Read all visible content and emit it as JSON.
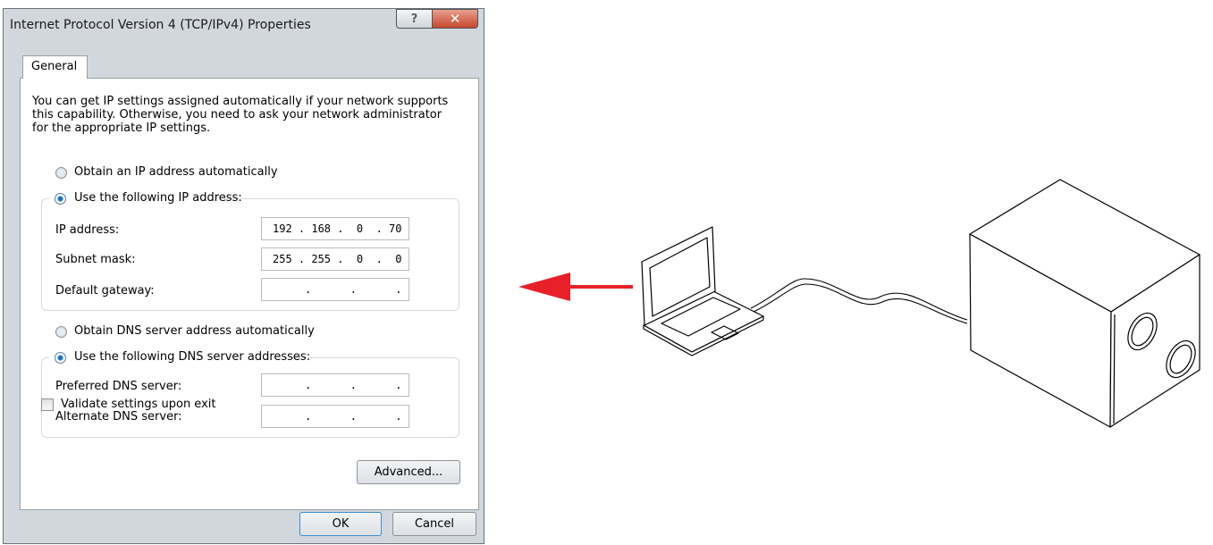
{
  "window": {
    "title": "Internet Protocol Version 4 (TCP/IPv4) Properties",
    "help_glyph": "?",
    "close_glyph": "✕"
  },
  "tabs": [
    {
      "label": "General",
      "selected": true
    }
  ],
  "intro_text": "You can get IP settings assigned automatically if your network supports this capability. Otherwise, you need to ask your network administrator for the appropriate IP settings.",
  "ip_section": {
    "auto_label": "Obtain an IP address automatically",
    "manual_label": "Use the following IP address:",
    "selected": "manual",
    "fields": [
      {
        "label": "IP address:",
        "value": "192 . 168 .  0  . 70"
      },
      {
        "label": "Subnet mask:",
        "value": "255 . 255 .  0  .  0"
      },
      {
        "label": "Default gateway:",
        "value": "     .      .      ."
      }
    ]
  },
  "dns_section": {
    "auto_label": "Obtain DNS server address automatically",
    "manual_label": "Use the following DNS server addresses:",
    "selected": "manual",
    "fields": [
      {
        "label": "Preferred DNS server:",
        "value": "     .      .      ."
      },
      {
        "label": "Alternate DNS server:",
        "value": "     .      .      ."
      }
    ]
  },
  "validate": {
    "label": "Validate settings upon exit",
    "checked": false
  },
  "buttons": {
    "advanced": "Advanced...",
    "ok": "OK",
    "cancel": "Cancel"
  },
  "colors": {
    "arrow": "#e8202a",
    "close_button": "#c7462e",
    "radio_selected": "#2a86d8"
  },
  "illustration": {
    "icons": [
      "red-arrow-icon",
      "laptop-icon",
      "cable-icon",
      "camera-box-icon"
    ]
  }
}
